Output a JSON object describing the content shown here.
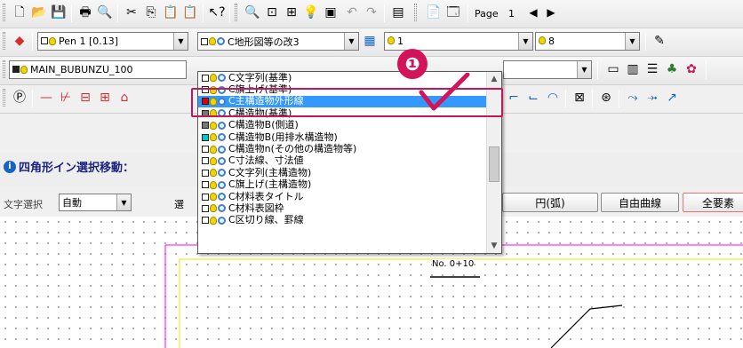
{
  "toolbar1": {
    "page_label": "Page",
    "page_number": "1",
    "next_arrow": "◀",
    "play_arrow": "▶"
  },
  "toolbar2": {
    "pen_combo": "Pen 1 [0.13]",
    "layer_combo": "C地形図等の改3",
    "num_combo": "1",
    "num_combo2": "8"
  },
  "toolbar3": {
    "bubunzu_combo": "MAIN_BUBUNZU_100"
  },
  "title_bar": {
    "text": "四角形イン選択移動："
  },
  "options": {
    "char_select_label": "文字選択",
    "char_select_value": "自動",
    "select_label": "選",
    "btn_arc": "円(弧)",
    "btn_free_curve": "自由曲線",
    "btn_all": "全要素"
  },
  "dropdown": {
    "items": [
      "C文字列(基準)",
      "C旗上げ(基準)",
      "C主構造物外形線",
      "C構造物(基準)",
      "C構造物B(側道)",
      "C構造物B(用排水構造物)",
      "C構造物n(その他の構造物等)",
      "C寸法線、寸法値",
      "C文字列(主構造物)",
      "C旗上げ(主構造物)",
      "C材料表タイトル",
      "C材料表図枠",
      "C区切り線、罫線"
    ],
    "selected_index": 2,
    "colors": [
      "#ffffff",
      "#ffffff",
      "#e00000",
      "#777777",
      "#777777",
      "#00c8c8",
      "#ffffff",
      "#ffffff",
      "#ffffff",
      "#ffffff",
      "#ffffff",
      "#ffffff",
      "#ffffff"
    ]
  },
  "callout": {
    "number": "❶"
  },
  "drawing": {
    "station_label": "No. 0+10"
  },
  "colors": {
    "highlight": "#3399ff",
    "callout": "#d4145a",
    "guide_pink": "#ff00ff",
    "guide_yellow": "#e8e800"
  }
}
